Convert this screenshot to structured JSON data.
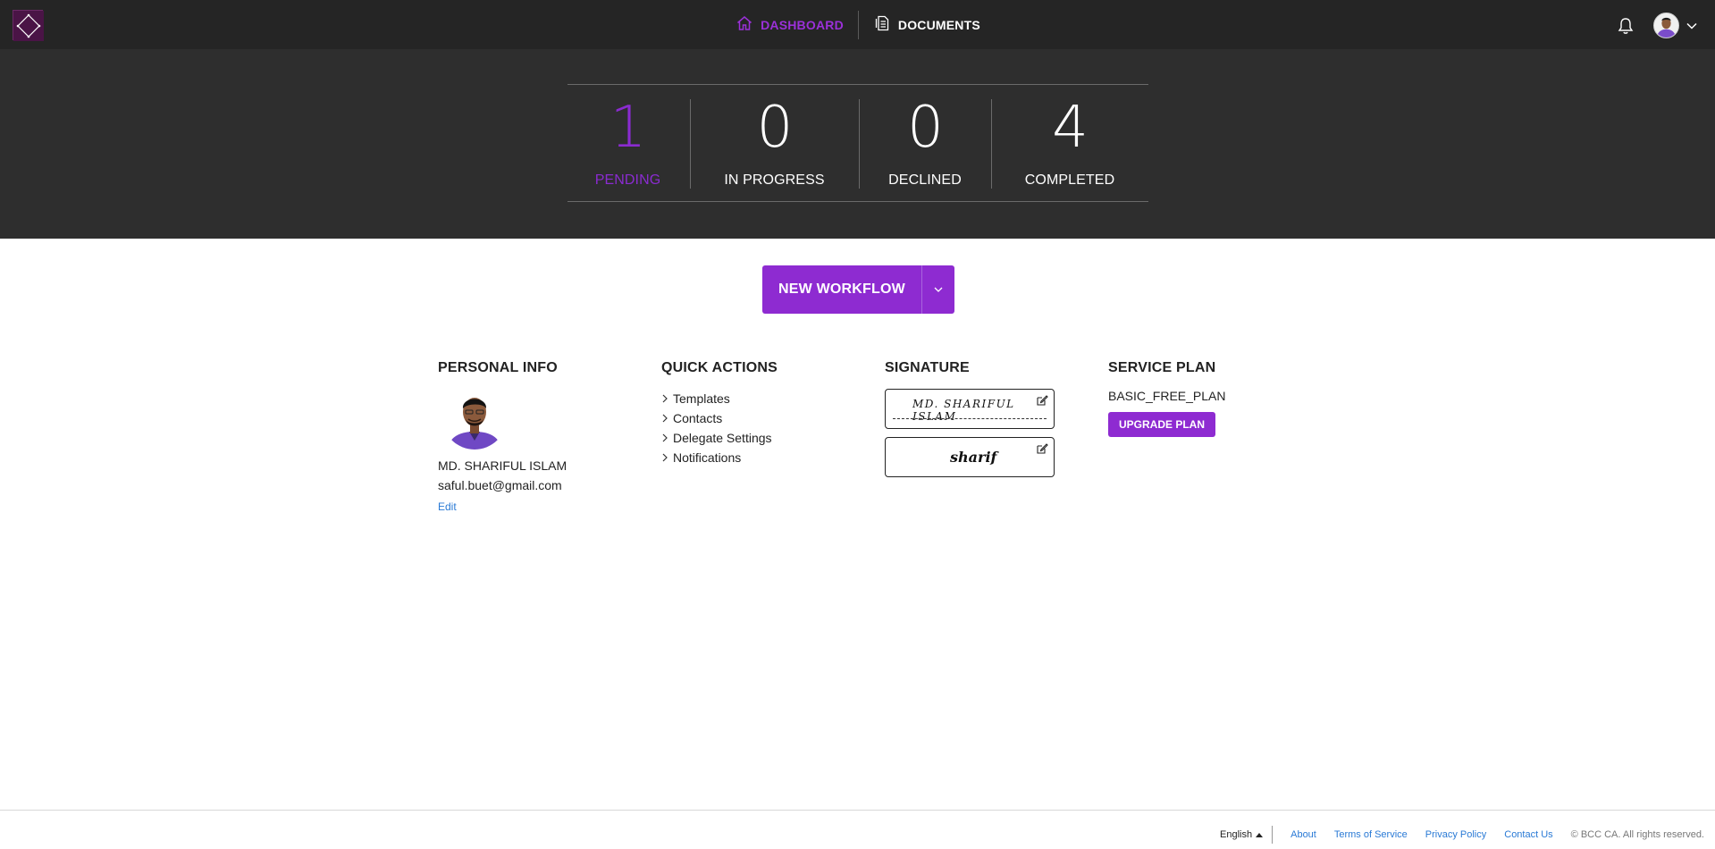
{
  "nav": {
    "logo": "logo-icon",
    "items": [
      {
        "label": "DASHBOARD",
        "icon": "home-icon",
        "active": true
      },
      {
        "label": "DOCUMENTS",
        "icon": "document-icon",
        "active": false
      }
    ],
    "notification_icon": "bell-icon",
    "user_menu_icon": "chevron-down-icon"
  },
  "stats": [
    {
      "value": "1",
      "label": "PENDING"
    },
    {
      "value": "0",
      "label": "IN PROGRESS"
    },
    {
      "value": "0",
      "label": "DECLINED"
    },
    {
      "value": "4",
      "label": "COMPLETED"
    }
  ],
  "new_workflow": {
    "label": "NEW WORKFLOW"
  },
  "personal_info": {
    "title": "PERSONAL INFO",
    "name": "MD. SHARIFUL ISLAM",
    "email": "saful.buet@gmail.com",
    "edit": "Edit"
  },
  "quick_actions": {
    "title": "QUICK ACTIONS",
    "items": [
      "Templates",
      "Contacts",
      "Delegate Settings",
      "Notifications"
    ]
  },
  "signature": {
    "title": "SIGNATURE",
    "initials_text": "MD. SHARIFUL ISLAM",
    "signature_text": "sharif"
  },
  "service_plan": {
    "title": "SERVICE PLAN",
    "plan": "BASIC_FREE_PLAN",
    "upgrade": "UPGRADE PLAN"
  },
  "footer": {
    "language": "English",
    "links": [
      "About",
      "Terms of Service",
      "Privacy Policy",
      "Contact Us"
    ],
    "copyright": "© BCC CA. All rights reserved."
  },
  "colors": {
    "accent": "#8e2bd1",
    "topbar": "#252525",
    "band": "#2e2e2e",
    "link": "#2a7ad5"
  }
}
